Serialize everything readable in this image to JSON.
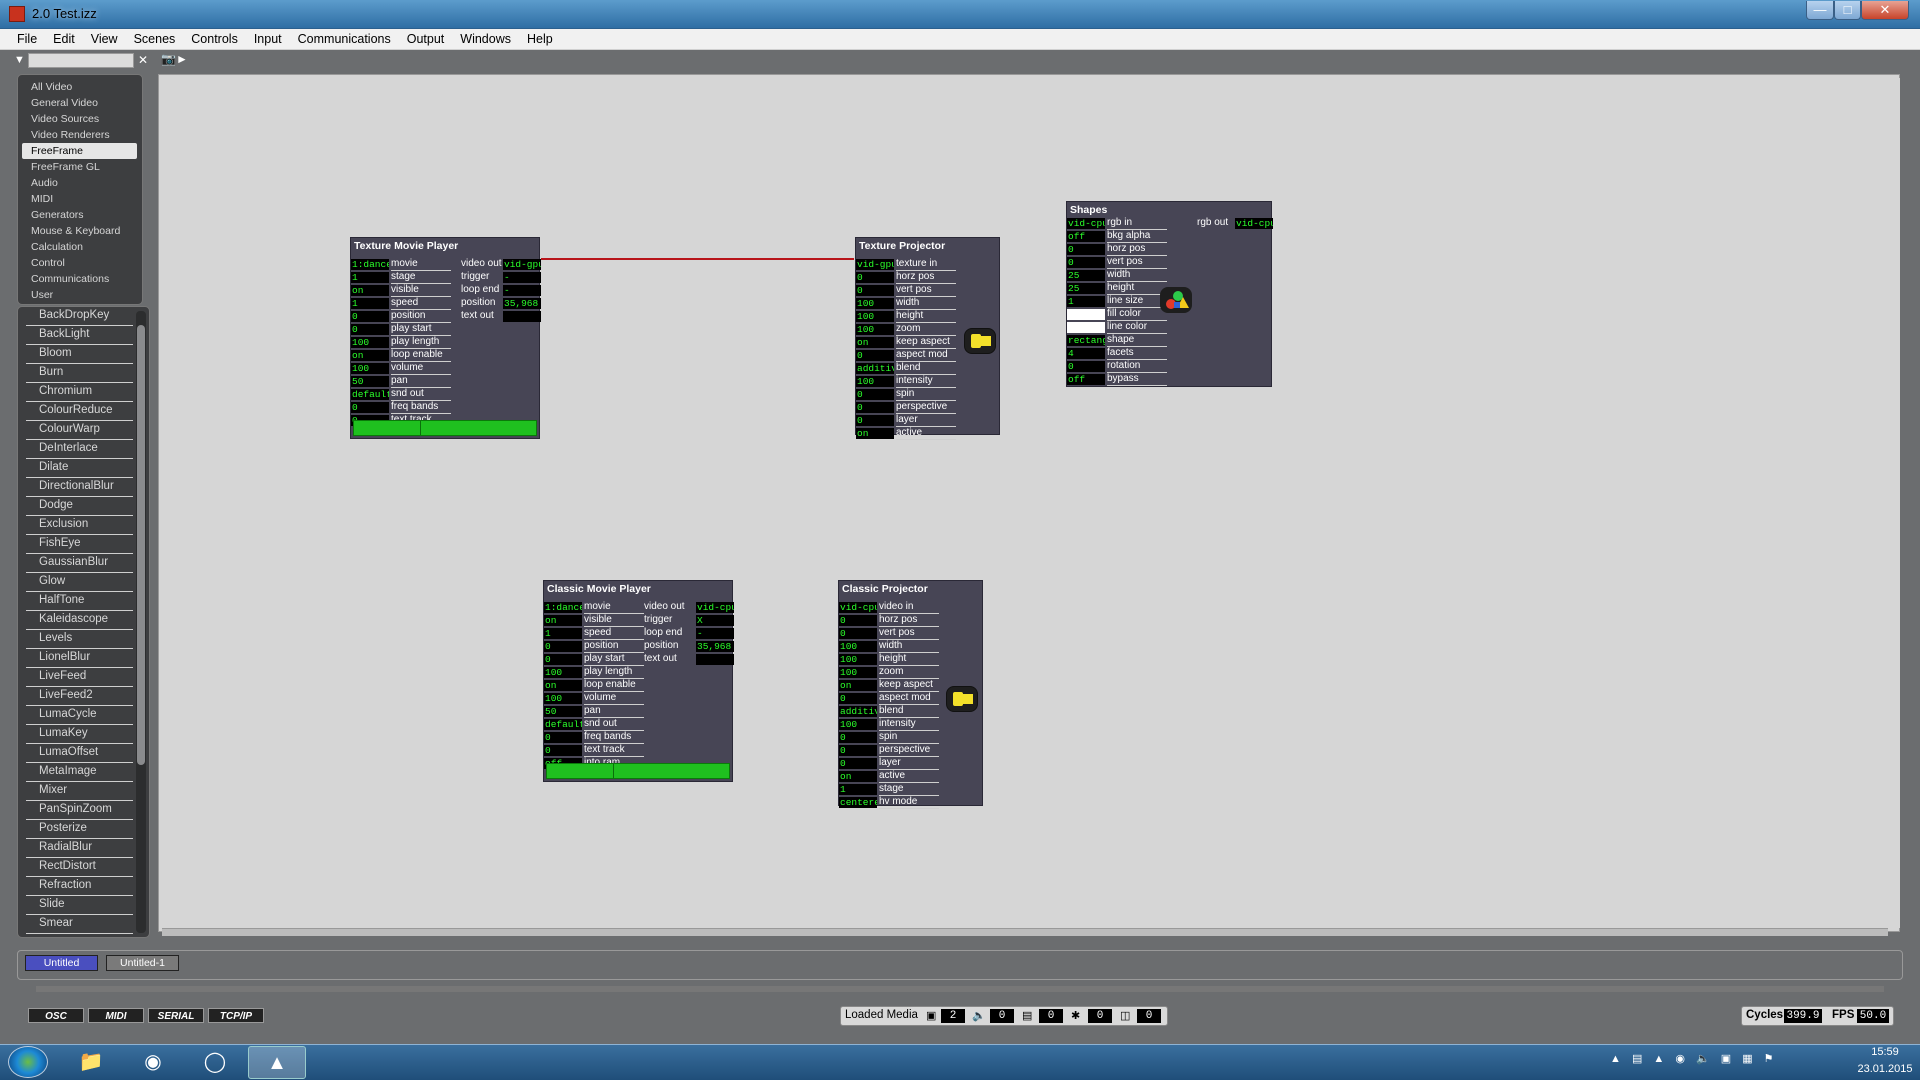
{
  "window": {
    "title": "2.0 Test.izz"
  },
  "menu": [
    "File",
    "Edit",
    "View",
    "Scenes",
    "Controls",
    "Input",
    "Communications",
    "Output",
    "Windows",
    "Help"
  ],
  "categories": [
    "All Video",
    "General Video",
    "Video Sources",
    "Video Renderers",
    "FreeFrame",
    "FreeFrame GL",
    "Audio",
    "MIDI",
    "Generators",
    "Mouse & Keyboard",
    "Calculation",
    "Control",
    "Communications",
    "User"
  ],
  "selected_category": "FreeFrame",
  "actors_list": [
    "BackDropKey",
    "BackLight",
    "Bloom",
    "Burn",
    "Chromium",
    "ColourReduce",
    "ColourWarp",
    "DeInterlace",
    "Dilate",
    "DirectionalBlur",
    "Dodge",
    "Exclusion",
    "FishEye",
    "GaussianBlur",
    "Glow",
    "HalfTone",
    "Kaleidascope",
    "Levels",
    "LionelBlur",
    "LiveFeed",
    "LiveFeed2",
    "LumaCycle",
    "LumaKey",
    "LumaOffset",
    "MetaImage",
    "Mixer",
    "PanSpinZoom",
    "Posterize",
    "RadialBlur",
    "RectDistort",
    "Refraction",
    "Slide",
    "Smear"
  ],
  "texture_movie_player": {
    "title": "Texture Movie Player",
    "inputs": [
      {
        "value": "1:dance",
        "label": "movie"
      },
      {
        "value": "1",
        "label": "stage"
      },
      {
        "value": "on",
        "label": "visible"
      },
      {
        "value": "1",
        "label": "speed"
      },
      {
        "value": "0",
        "label": "position"
      },
      {
        "value": "0",
        "label": "play start"
      },
      {
        "value": "100",
        "label": "play length"
      },
      {
        "value": "on",
        "label": "loop enable"
      },
      {
        "value": "100",
        "label": "volume"
      },
      {
        "value": "50",
        "label": "pan"
      },
      {
        "value": "default",
        "label": "snd out"
      },
      {
        "value": "0",
        "label": "freq bands"
      },
      {
        "value": "0",
        "label": "text track"
      }
    ],
    "outputs": [
      {
        "label": "video out",
        "value": "vid-gpu"
      },
      {
        "label": "trigger",
        "value": "-"
      },
      {
        "label": "loop end",
        "value": "-"
      },
      {
        "label": "position",
        "value": "35,968"
      },
      {
        "label": "text out",
        "value": ""
      }
    ],
    "progress": 0.36
  },
  "texture_projector": {
    "title": "Texture Projector",
    "inputs": [
      {
        "value": "vid-gpu",
        "label": "texture in"
      },
      {
        "value": "0",
        "label": "horz pos"
      },
      {
        "value": "0",
        "label": "vert pos"
      },
      {
        "value": "100",
        "label": "width"
      },
      {
        "value": "100",
        "label": "height"
      },
      {
        "value": "100",
        "label": "zoom"
      },
      {
        "value": "on",
        "label": "keep aspect"
      },
      {
        "value": "0",
        "label": "aspect mod"
      },
      {
        "value": "additive",
        "label": "blend"
      },
      {
        "value": "100",
        "label": "intensity"
      },
      {
        "value": "0",
        "label": "spin"
      },
      {
        "value": "0",
        "label": "perspective"
      },
      {
        "value": "0",
        "label": "layer"
      },
      {
        "value": "on",
        "label": "active"
      }
    ]
  },
  "shapes": {
    "title": "Shapes",
    "inputs": [
      {
        "value": "vid-cpu",
        "label": "rgb in"
      },
      {
        "value": "off",
        "label": "bkg alpha"
      },
      {
        "value": "0",
        "label": "horz pos"
      },
      {
        "value": "0",
        "label": "vert pos"
      },
      {
        "value": "25",
        "label": "width"
      },
      {
        "value": "25",
        "label": "height"
      },
      {
        "value": "1",
        "label": "line size"
      },
      {
        "value": "",
        "label": "fill color"
      },
      {
        "value": "",
        "label": "line color"
      },
      {
        "value": "rectang",
        "label": "shape"
      },
      {
        "value": "4",
        "label": "facets"
      },
      {
        "value": "0",
        "label": "rotation"
      },
      {
        "value": "off",
        "label": "bypass"
      }
    ],
    "outputs": [
      {
        "label": "rgb out",
        "value": "vid-cpu"
      }
    ]
  },
  "classic_movie_player": {
    "title": "Classic Movie Player",
    "inputs": [
      {
        "value": "1:dance",
        "label": "movie"
      },
      {
        "value": "on",
        "label": "visible"
      },
      {
        "value": "1",
        "label": "speed"
      },
      {
        "value": "0",
        "label": "position"
      },
      {
        "value": "0",
        "label": "play start"
      },
      {
        "value": "100",
        "label": "play length"
      },
      {
        "value": "on",
        "label": "loop enable"
      },
      {
        "value": "100",
        "label": "volume"
      },
      {
        "value": "50",
        "label": "pan"
      },
      {
        "value": "default",
        "label": "snd out"
      },
      {
        "value": "0",
        "label": "freq bands"
      },
      {
        "value": "0",
        "label": "text track"
      },
      {
        "value": "off",
        "label": "into ram"
      }
    ],
    "outputs": [
      {
        "label": "video out",
        "value": "vid-cpu"
      },
      {
        "label": "trigger",
        "value": "X"
      },
      {
        "label": "loop end",
        "value": "-"
      },
      {
        "label": "position",
        "value": "35,968"
      },
      {
        "label": "text out",
        "value": ""
      }
    ],
    "progress": 0.36
  },
  "classic_projector": {
    "title": "Classic Projector",
    "inputs": [
      {
        "value": "vid-cpu",
        "label": "video in"
      },
      {
        "value": "0",
        "label": "horz pos"
      },
      {
        "value": "0",
        "label": "vert pos"
      },
      {
        "value": "100",
        "label": "width"
      },
      {
        "value": "100",
        "label": "height"
      },
      {
        "value": "100",
        "label": "zoom"
      },
      {
        "value": "on",
        "label": "keep aspect"
      },
      {
        "value": "0",
        "label": "aspect mod"
      },
      {
        "value": "additive",
        "label": "blend"
      },
      {
        "value": "100",
        "label": "intensity"
      },
      {
        "value": "0",
        "label": "spin"
      },
      {
        "value": "0",
        "label": "perspective"
      },
      {
        "value": "0",
        "label": "layer"
      },
      {
        "value": "on",
        "label": "active"
      },
      {
        "value": "1",
        "label": "stage"
      },
      {
        "value": "centere",
        "label": "hv mode"
      }
    ]
  },
  "scene_tabs": [
    "Untitled",
    "Untitled-1"
  ],
  "protocols": [
    "OSC",
    "MIDI",
    "SERIAL",
    "TCP/IP"
  ],
  "loaded_media": {
    "label": "Loaded Media",
    "movies": "2",
    "sounds": "0",
    "pictures": "0",
    "video_in": "0",
    "other": "0"
  },
  "stats": {
    "cycles_label": "Cycles",
    "cycles": "399.9",
    "fps_label": "FPS",
    "fps": "50.0"
  },
  "clock": {
    "time": "15:59",
    "date": "23.01.2015"
  },
  "colors": {
    "value_green": "#2bff2b",
    "wire": "#b8141a",
    "actor_bg": "#474555",
    "selected_tab": "#4a4fbf"
  }
}
